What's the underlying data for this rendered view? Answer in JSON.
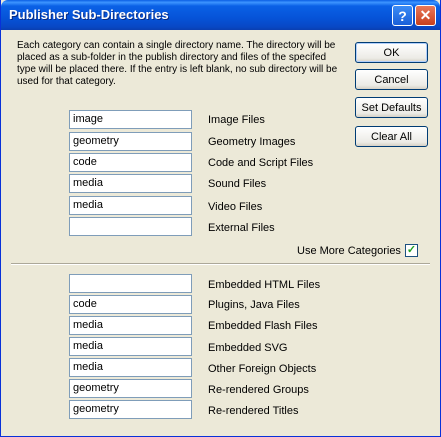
{
  "window": {
    "title": "Publisher Sub-Directories",
    "help_glyph": "?",
    "close_glyph": "✕"
  },
  "description": "Each category can contain a single directory name. The directory will be placed as a sub-folder in the publish directory and files of the specifed type will be placed there. If the entry is left blank, no sub directory will be used for that category.",
  "buttons": {
    "ok": "OK",
    "cancel": "Cancel",
    "set_defaults": "Set Defaults",
    "clear_all": "Clear All"
  },
  "basic_categories": [
    {
      "value": "image",
      "label": "Image Files"
    },
    {
      "value": "geometry",
      "label": "Geometry Images"
    },
    {
      "value": "code",
      "label": "Code and Script Files"
    },
    {
      "value": "media",
      "label": "Sound Files"
    },
    {
      "value": "media",
      "label": "Video Files"
    },
    {
      "value": "",
      "label": "External Files"
    }
  ],
  "more_categories_toggle": {
    "label": "Use More Categories",
    "checked": true,
    "check_glyph": "✓"
  },
  "more_categories": [
    {
      "value": "",
      "label": "Embedded HTML Files"
    },
    {
      "value": "code",
      "label": "Plugins, Java Files"
    },
    {
      "value": "media",
      "label": "Embedded Flash Files"
    },
    {
      "value": "media",
      "label": "Embedded SVG"
    },
    {
      "value": "media",
      "label": "Other Foreign Objects"
    },
    {
      "value": "geometry",
      "label": "Re-rendered Groups"
    },
    {
      "value": "geometry",
      "label": "Re-rendered Titles"
    }
  ]
}
